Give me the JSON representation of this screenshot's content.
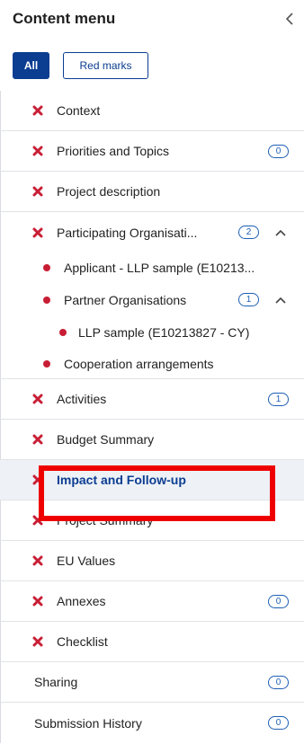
{
  "header": {
    "title": "Content menu"
  },
  "filters": {
    "all_label": "All",
    "red_marks_label": "Red marks"
  },
  "menu": {
    "context": {
      "label": "Context"
    },
    "priorities": {
      "label": "Priorities and Topics",
      "count": "0"
    },
    "project_description": {
      "label": "Project description"
    },
    "participating": {
      "label": "Participating Organisati...",
      "count": "2"
    },
    "applicant": {
      "label": "Applicant - LLP sample (E10213..."
    },
    "partners": {
      "label": "Partner Organisations",
      "count": "1"
    },
    "llp_sample": {
      "label": "LLP sample (E10213827 - CY)"
    },
    "cooperation": {
      "label": "Cooperation arrangements"
    },
    "activities": {
      "label": "Activities",
      "count": "1"
    },
    "budget": {
      "label": "Budget Summary"
    },
    "impact": {
      "label": "Impact and Follow-up"
    },
    "project_summary": {
      "label": "Project Summary"
    },
    "eu_values": {
      "label": "EU Values"
    },
    "annexes": {
      "label": "Annexes",
      "count": "0"
    },
    "checklist": {
      "label": "Checklist"
    },
    "sharing": {
      "label": "Sharing",
      "count": "0"
    },
    "submission_history": {
      "label": "Submission History",
      "count": "0"
    }
  },
  "colors": {
    "primary": "#0b3d91",
    "error_red": "#c81e35",
    "highlight_red": "#ee0000",
    "badge_blue": "#1d5fb4"
  }
}
